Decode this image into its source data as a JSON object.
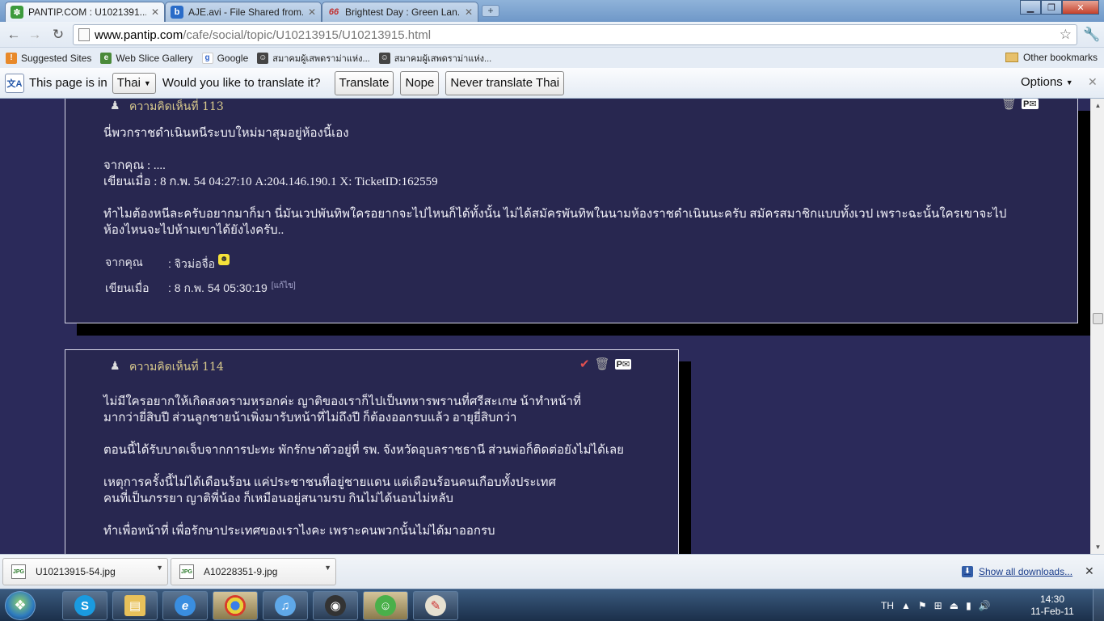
{
  "browser": {
    "tabs": [
      {
        "title": "PANTIP.COM : U1021391...",
        "icon": "cactus-icon",
        "active": true
      },
      {
        "title": "AJE.avi - File Shared from...",
        "icon": "b-letter-icon",
        "active": false
      },
      {
        "title": "Brightest Day : Green Lan...",
        "icon": "66-logo-icon",
        "active": false
      }
    ],
    "url_domain": "www.pantip.com",
    "url_path": "/cafe/social/topic/U10213915/U10213915.html",
    "bookmarks": [
      {
        "label": "Suggested Sites",
        "icon": "suggested-sites-icon"
      },
      {
        "label": "Web Slice Gallery",
        "icon": "web-slice-icon"
      },
      {
        "label": "Google",
        "icon": "google-icon"
      },
      {
        "label": "สมาคมผู้เสพดราม่าแห่ง...",
        "icon": "avatar-icon"
      },
      {
        "label": "สมาคมผู้เสพดราม่าแห่ง...",
        "icon": "avatar-icon"
      }
    ],
    "other_bookmarks": "Other bookmarks"
  },
  "translate_bar": {
    "prefix": "This page is in",
    "language": "Thai",
    "question": "Would you like to translate it?",
    "translate": "Translate",
    "nope": "Nope",
    "never": "Never translate Thai",
    "options": "Options"
  },
  "comments": [
    {
      "header": "ความคิดเห็นที่ 113",
      "quote_lines": "นี่พวกราชดำเนินหนีระบบใหม่มาสุมอยู่ห้องนี้เอง\n\nจากคุณ : ....\nเขียนเมื่อ : 8 ก.พ. 54 04:27:10 A:204.146.190.1 X: TicketID:162559\n\nทำไมต้องหนีละครับอยากมาก็มา  นี่มันเวปพันทิพใครอยากจะไปไหนก็ได้ทั้งนั้น  ไม่ได้สมัครพันทิพในนามห้องราชดำเนินนะครับ  สมัครสมาชิกแบบทั้งเวป เพราะฉะนั้นใครเขาจะไป\nห้องไหนจะไปห้ามเขาได้ยังไงครับ..",
      "author_label": "จากคุณ",
      "author": ": จิวม่อจื่อ",
      "date_label": "เขียนเมื่อ",
      "date": ": 8 ก.พ. 54 05:30:19",
      "edit": "[แก้ไข]"
    },
    {
      "header": "ความคิดเห็นที่ 114",
      "body": "ไม่มีใครอยากให้เกิดสงครามหรอกค่ะ  ญาติของเราก็ไปเป็นทหารพรานที่ศรีสะเกษ น้าทำหน้าที่\nมากว่ายี่สิบปี  ส่วนลูกชายน้าเพิ่งมารับหน้าที่ไม่ถึงปี  ก็ต้องออกรบแล้ว อายุยี่สิบกว่า\n\nตอนนี้ได้รับบาดเจ็บจากการปะทะ  พักรักษาตัวอยู่ที่ รพ. จังหวัดอุบลราชธานี  ส่วนพ่อก็ติดต่อยังไม่ได้เลย\n\nเหตุการครั้งนี้ไม่ได้เดือนร้อน แค่ประชาชนที่อยู่ชายแดน  แต่เดือนร้อนคนเกือบทั้งประเทศ\nคนที่เป็นภรรยา ญาติพี่น้อง  ก็เหมือนอยู่สนามรบ  กินไม่ได้นอนไม่หลับ\n\nทำเพื่อหน้าที่ เพื่อรักษาประเทศของเราไงคะ  เพราะคนพวกนั้นไม่ได้มาออกรบ"
    }
  ],
  "downloads": {
    "items": [
      {
        "filename": "U10213915-54.jpg",
        "icon": "jpeg-file-icon"
      },
      {
        "filename": "A10228351-9.jpg",
        "icon": "jpeg-file-icon"
      }
    ],
    "show_all": "Show all downloads..."
  },
  "taskbar": {
    "apps": [
      {
        "name": "skype",
        "icon": "skype-icon"
      },
      {
        "name": "explorer",
        "icon": "folder-icon"
      },
      {
        "name": "internet-explorer",
        "icon": "ie-icon"
      },
      {
        "name": "chrome",
        "icon": "chrome-icon"
      },
      {
        "name": "itunes",
        "icon": "itunes-icon"
      },
      {
        "name": "camera",
        "icon": "camera-icon"
      },
      {
        "name": "messenger",
        "icon": "messenger-icon"
      },
      {
        "name": "paint",
        "icon": "paint-icon"
      }
    ],
    "language": "TH",
    "time": "14:30",
    "date": "11-Feb-11"
  },
  "colors": {
    "page_bg": "#2b2a5a",
    "comment_bg": "#282750",
    "header_text": "#d8c98c",
    "link": "#1b3e8c"
  }
}
